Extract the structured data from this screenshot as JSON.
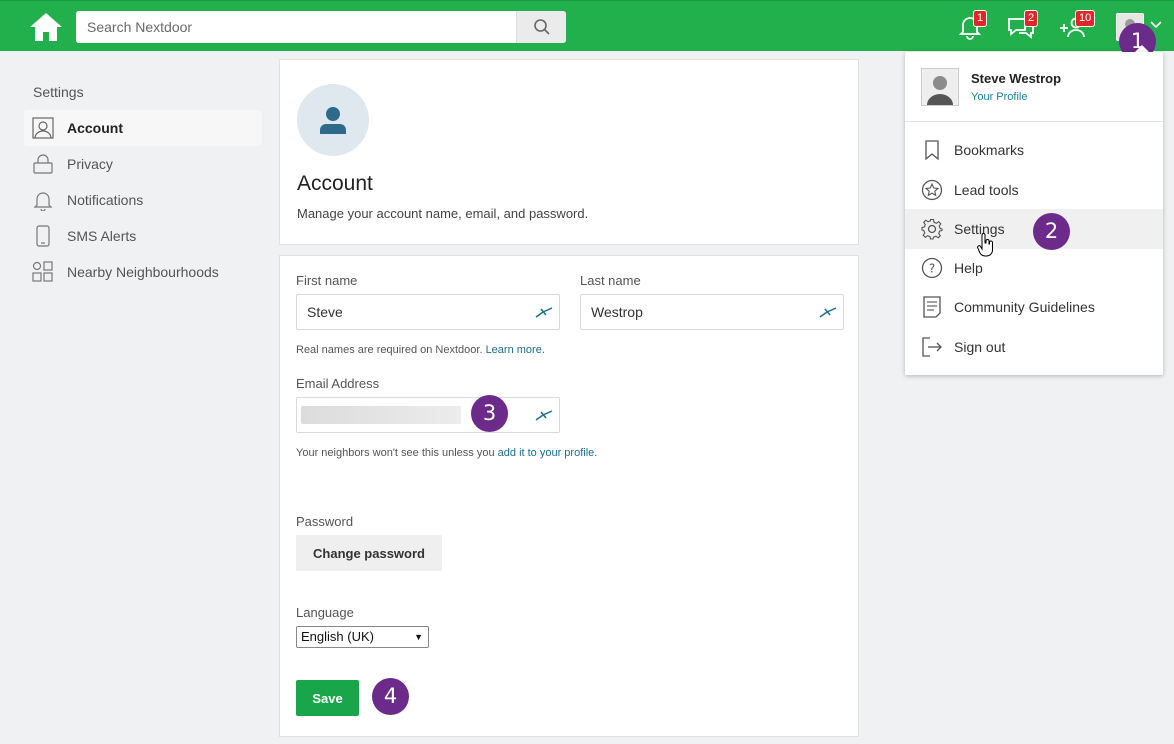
{
  "header": {
    "search_placeholder": "Search Nextdoor",
    "notifications_badge": "1",
    "messages_badge": "2",
    "invites_badge": "10"
  },
  "steps": [
    "1",
    "2",
    "3",
    "4"
  ],
  "sidebar": {
    "title": "Settings",
    "items": [
      {
        "label": "Account",
        "icon": "user-icon"
      },
      {
        "label": "Privacy",
        "icon": "lock-icon"
      },
      {
        "label": "Notifications",
        "icon": "bell-icon"
      },
      {
        "label": "SMS Alerts",
        "icon": "phone-icon"
      },
      {
        "label": "Nearby Neighbourhoods",
        "icon": "grid-icon"
      }
    ]
  },
  "account": {
    "title": "Account",
    "description": "Manage your account name, email, and password."
  },
  "form": {
    "first_name_label": "First name",
    "first_name_value": "Steve",
    "last_name_label": "Last name",
    "last_name_value": "Westrop",
    "names_hint": "Real names are required on Nextdoor. ",
    "learn_more": "Learn more.",
    "email_label": "Email Address",
    "email_hint": "Your neighbors won't see this unless you ",
    "email_hint_link": "add it to your profile.",
    "password_label": "Password",
    "change_password": "Change password",
    "language_label": "Language",
    "language_value": "English (UK)",
    "save": "Save"
  },
  "dropdown": {
    "name": "Steve Westrop",
    "profile_link": "Your Profile",
    "items": [
      {
        "label": "Bookmarks",
        "icon": "bookmark-icon"
      },
      {
        "label": "Lead tools",
        "icon": "star-icon"
      },
      {
        "label": "Settings",
        "icon": "gear-icon"
      },
      {
        "label": "Help",
        "icon": "help-icon"
      },
      {
        "label": "Community Guidelines",
        "icon": "document-icon"
      },
      {
        "label": "Sign out",
        "icon": "sign-out-icon"
      }
    ]
  },
  "colors": {
    "brand": "#21b04b",
    "save_button": "#19a64a",
    "step_marker": "#6c2a8a",
    "badge": "#e0262b",
    "link": "#1a7ea0"
  }
}
